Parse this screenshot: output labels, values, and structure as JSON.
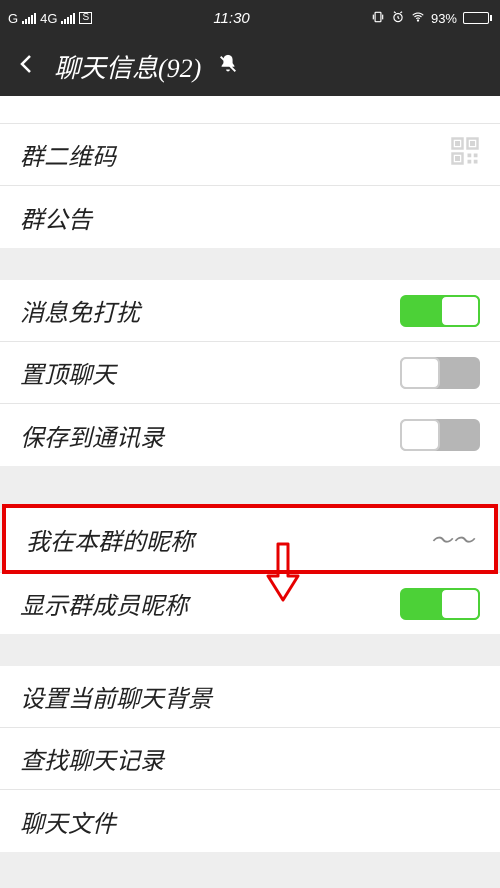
{
  "status": {
    "carrier": "G",
    "net": "4G",
    "sbox": "S",
    "time": "11:30",
    "battery_pct": "93%"
  },
  "header": {
    "title": "聊天信息(92)"
  },
  "rows": {
    "qr": "群二维码",
    "announcement": "群公告",
    "mute": "消息免打扰",
    "pin": "置顶聊天",
    "save_contacts": "保存到通讯录",
    "my_nick": "我在本群的昵称",
    "my_nick_value": "～～",
    "show_nick": "显示群成员昵称",
    "bg": "设置当前聊天背景",
    "search": "查找聊天记录",
    "files": "聊天文件"
  }
}
